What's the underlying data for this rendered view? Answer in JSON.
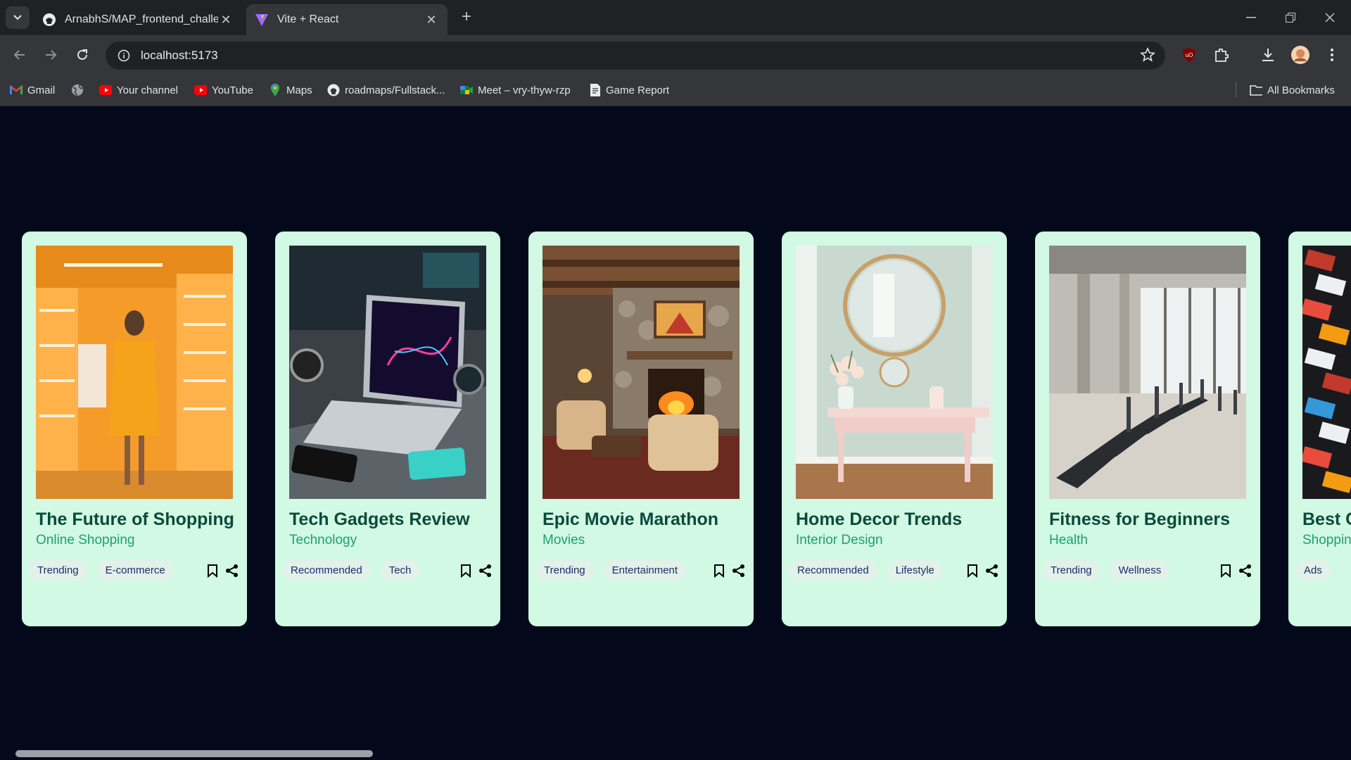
{
  "browser": {
    "tabs": [
      {
        "title": "ArnabhS/MAP_frontend_challenge",
        "favicon": "github-icon",
        "active": false
      },
      {
        "title": "Vite + React",
        "favicon": "vite-icon",
        "active": true
      }
    ],
    "url": "localhost:5173",
    "bookmarks": [
      {
        "label": "Gmail",
        "icon": "gmail-icon"
      },
      {
        "label": "",
        "icon": "globe-icon"
      },
      {
        "label": "Your channel",
        "icon": "youtube-icon"
      },
      {
        "label": "YouTube",
        "icon": "youtube-icon"
      },
      {
        "label": "Maps",
        "icon": "maps-icon"
      },
      {
        "label": "roadmaps/Fullstack...",
        "icon": "github-icon"
      },
      {
        "label": "Meet – vry-thyw-rzp",
        "icon": "meet-icon"
      },
      {
        "label": "Game Report",
        "icon": "report-icon"
      }
    ],
    "all_bookmarks_label": "All Bookmarks"
  },
  "cards": [
    {
      "title": "The Future of Shopping",
      "category": "Online Shopping",
      "tags": [
        "Trending",
        "E-commerce"
      ],
      "image": "woman-in-orange-store"
    },
    {
      "title": "Tech Gadgets Review",
      "category": "Technology",
      "tags": [
        "Recommended",
        "Tech"
      ],
      "image": "laptop-and-smartwatches"
    },
    {
      "title": "Epic Movie Marathon",
      "category": "Movies",
      "tags": [
        "Trending",
        "Entertainment"
      ],
      "image": "cozy-living-room-fireplace"
    },
    {
      "title": "Home Decor Trends",
      "category": "Interior Design",
      "tags": [
        "Recommended",
        "Lifestyle"
      ],
      "image": "console-table-round-mirror"
    },
    {
      "title": "Fitness for Beginners",
      "category": "Health",
      "tags": [
        "Trending",
        "Wellness"
      ],
      "image": "gym-treadmills"
    },
    {
      "title": "Best C",
      "category": "Shoppin",
      "tags": [
        "Ads"
      ],
      "image": "stacked-cards"
    }
  ],
  "colors": {
    "page_bg": "#03091a",
    "card_bg": "#d1f9e4",
    "card_title": "#0b4a3a",
    "card_category": "#22a06b",
    "tag_bg": "#e2f1ea",
    "tag_text": "#1f2c6b"
  }
}
